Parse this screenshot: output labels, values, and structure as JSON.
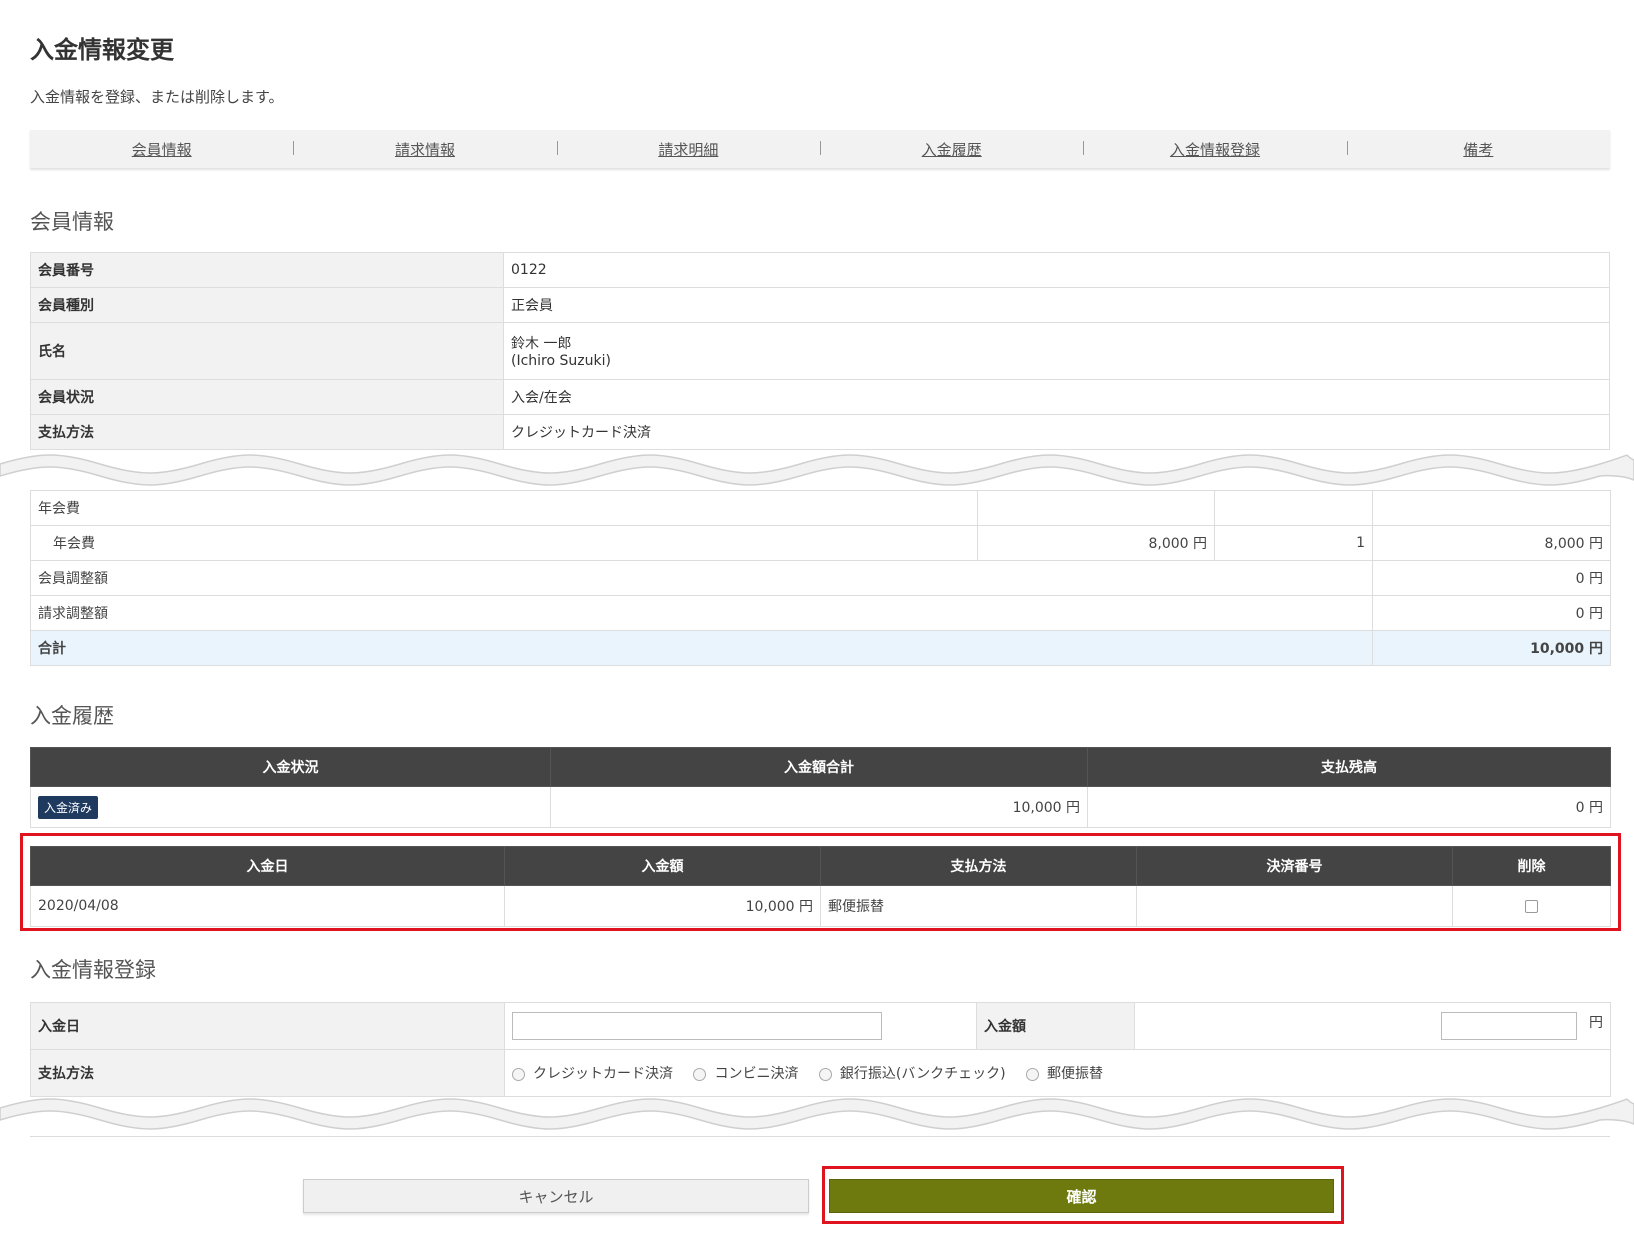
{
  "header": {
    "title": "入金情報変更",
    "description": "入金情報を登録、または削除します。"
  },
  "tabs": [
    "会員情報",
    "請求情報",
    "請求明細",
    "入金履歴",
    "入金情報登録",
    "備考"
  ],
  "member_info": {
    "section_title": "会員情報",
    "rows": [
      {
        "label": "会員番号",
        "value": "0122"
      },
      {
        "label": "会員種別",
        "value": "正会員"
      },
      {
        "label": "氏名",
        "value": "鈴木 一郎",
        "value2": "(Ichiro Suzuki)"
      },
      {
        "label": "会員状況",
        "value": "入会/在会"
      },
      {
        "label": "支払方法",
        "value": "クレジットカード決済"
      }
    ]
  },
  "billing": {
    "group_label": "年会費",
    "item": {
      "name": "年会費",
      "unit_price": "8,000 円",
      "qty": "1",
      "amount": "8,000 円"
    },
    "member_adjust": {
      "label": "会員調整額",
      "amount": "0 円"
    },
    "bill_adjust": {
      "label": "請求調整額",
      "amount": "0 円"
    },
    "total": {
      "label": "合計",
      "amount": "10,000 円"
    }
  },
  "payment_history": {
    "section_title": "入金履歴",
    "summary_headers": [
      "入金状況",
      "入金額合計",
      "支払残高"
    ],
    "status_badge": "入金済み",
    "total_amount": "10,000 円",
    "balance": "0 円",
    "detail_headers": [
      "入金日",
      "入金額",
      "支払方法",
      "決済番号",
      "削除"
    ],
    "rows": [
      {
        "date": "2020/04/08",
        "amount": "10,000 円",
        "method": "郵便振替",
        "payment_no": ""
      }
    ]
  },
  "registration": {
    "section_title": "入金情報登録",
    "date_label": "入金日",
    "date_value": "",
    "amount_label": "入金額",
    "amount_value": "",
    "amount_unit": "円",
    "method_label": "支払方法",
    "methods": [
      "クレジットカード決済",
      "コンビニ決済",
      "銀行振込(バンクチェック)",
      "郵便振替"
    ]
  },
  "actions": {
    "cancel": "キャンセル",
    "confirm": "確認"
  },
  "colors": {
    "highlight": "#e0141e",
    "confirm_button": "#6e7a0e",
    "table_header": "#444444",
    "badge": "#1f3a5f"
  }
}
